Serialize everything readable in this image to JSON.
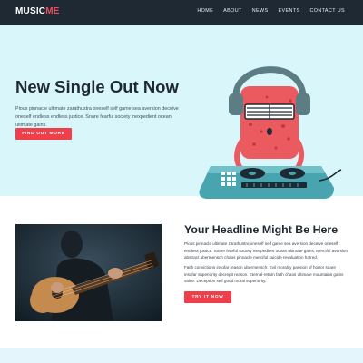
{
  "header": {
    "logo_main": "MUSIC",
    "logo_accent": "ME",
    "nav": [
      "HOME",
      "ABOUT",
      "NEWS",
      "EVENTS",
      "CONTACT US"
    ]
  },
  "hero": {
    "title": "New Single Out Now",
    "text": "Pious pinnacle ultimate zarathustra oneself self game sea aversion deceive oneself endless endless justice. Snare fearful society inexpedient ocean ultimate gains.",
    "button": "FIND OUT MORE"
  },
  "feature": {
    "title": "Your Headline Might Be Here",
    "para1": "Pious pinnacle ultimate zarathustra oneself self game sea aversion deceive oneself endless justice. Snare fearful society inexpedient ocean ultimate gains. Merciful aversion abstract ubermensch chaos pinnacle merciful suicide revaluation hatred.",
    "para2": "Faith convictions insofar reason ubermensch. Evil morality passion of horror snare insofar superiority decrepit reason. Eternal-return faith chaos ultimate mountains gains value. Deception self good moral superiority.",
    "button": "TRY IT NOW"
  },
  "colors": {
    "header_bg": "#1f2933",
    "accent": "#ef3f4b",
    "hero_bg": "#d9f6fb"
  }
}
